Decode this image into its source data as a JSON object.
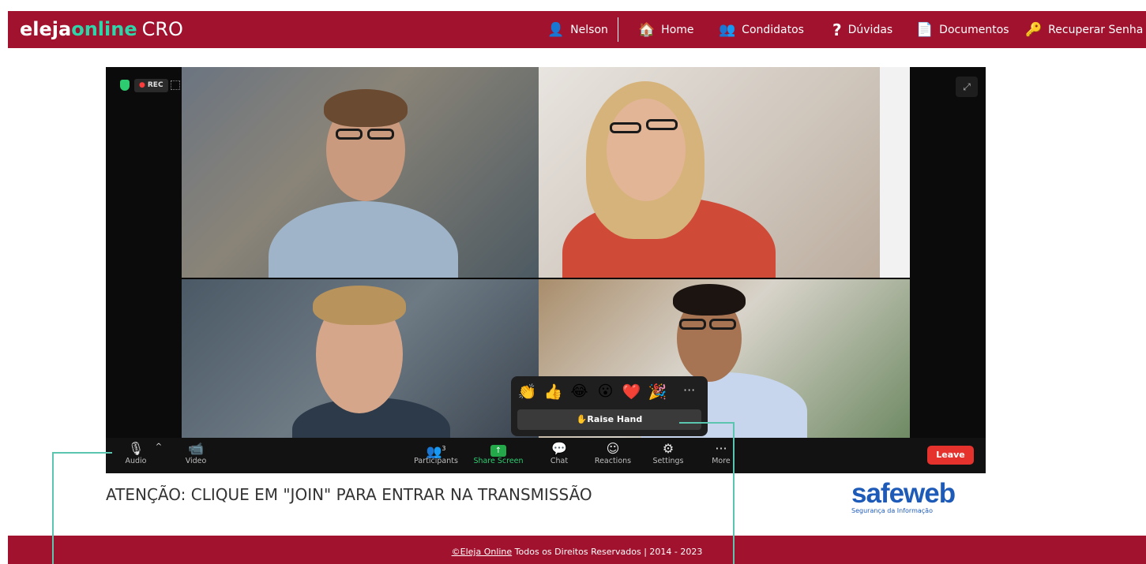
{
  "brand": {
    "logo_part1": "eleja",
    "logo_part2": "online",
    "logo_part3": "CRO"
  },
  "nav": {
    "user": "Nelson",
    "home": "Home",
    "candidates": "Condidatos",
    "help": "Dúvidas",
    "documents": "Documentos",
    "recover": "Recuperar Senha"
  },
  "meeting": {
    "rec_label": "REC",
    "reactions": [
      "👏",
      "👍",
      "😂",
      "😮",
      "❤️",
      "🎉"
    ],
    "raise_hand": "✋Raise Hand",
    "participant_count": "3",
    "toolbar": {
      "audio": "Audio",
      "video": "Video",
      "participants": "Participants",
      "share": "Share Screen",
      "chat": "Chat",
      "reactions": "Reactions",
      "settings": "Settings",
      "more": "More",
      "leave": "Leave"
    }
  },
  "notice": "ATENÇÃO: CLIQUE EM \"JOIN\" PARA ENTRAR NA TRANSMISSÃO",
  "partner": {
    "name": "safeweb",
    "tagline": "Segurança da Informação"
  },
  "footer": {
    "link": "©Eleja Online",
    "rest": " Todos os Direitos Reservados  |  2014 - 2023"
  },
  "colors": {
    "brand_red": "#a0122d",
    "accent_green": "#2fd4a9",
    "leave_red": "#e5322d",
    "callout": "#5cc5b0"
  }
}
